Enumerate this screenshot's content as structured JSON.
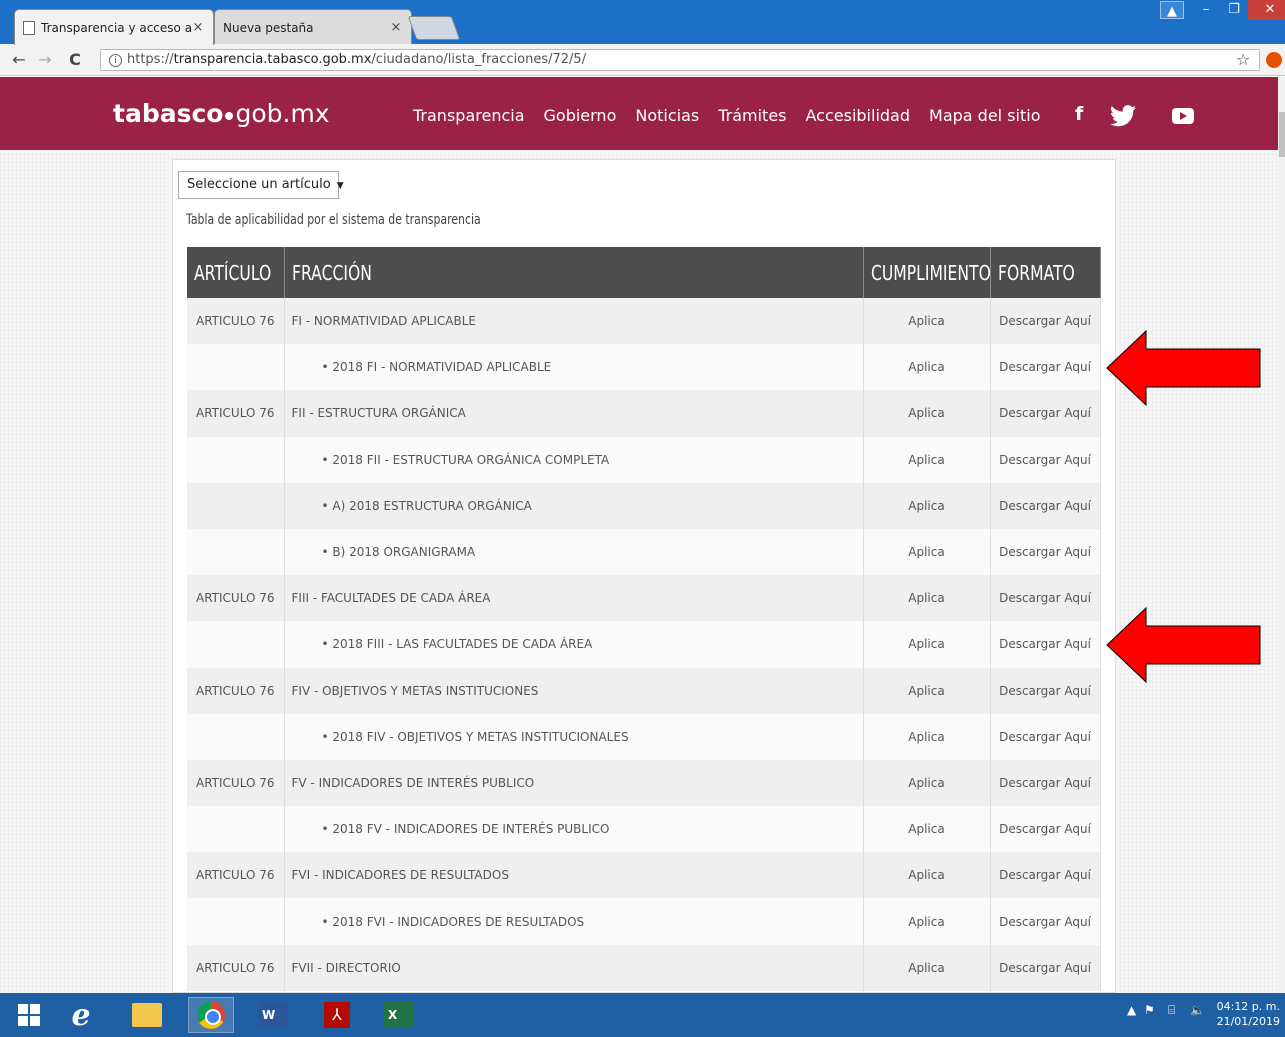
{
  "browser": {
    "tabs": [
      {
        "label": "Transparencia y acceso a",
        "active": true
      },
      {
        "label": "Nueva pestaña",
        "active": false
      }
    ],
    "close_glyph": "×",
    "url_prefix": "https://",
    "url_host": "transparencia.tabasco.gob.mx",
    "url_path": "/ciudadano/lista_fracciones/72/5/"
  },
  "site": {
    "brand_bold": "tabasco",
    "brand_light": "gob.mx",
    "nav": [
      "Transparencia",
      "Gobierno",
      "Noticias",
      "Trámites",
      "Accesibilidad",
      "Mapa del sitio"
    ],
    "social": {
      "facebook": "f"
    },
    "accent_color": "#9b2247"
  },
  "filter": {
    "select_value": "Seleccione un artículo",
    "caption": "Tabla de aplicabilidad por el sistema de transparencia"
  },
  "table": {
    "headers": {
      "articulo": "ARTÍCULO",
      "fraccion": "FRACCIÓN",
      "cumplimiento": "CUMPLIMIENTO",
      "formato": "FORMATO"
    },
    "rows": [
      {
        "articulo": "ARTICULO 76",
        "fraccion": "FI - NORMATIVIDAD APLICABLE",
        "cumplimiento": "Aplica",
        "formato": "Descargar Aquí",
        "sub": false
      },
      {
        "articulo": "",
        "fraccion": "• 2018 FI - NORMATIVIDAD APLICABLE",
        "cumplimiento": "Aplica",
        "formato": "Descargar Aquí",
        "sub": true
      },
      {
        "articulo": "ARTICULO 76",
        "fraccion": "FII - ESTRUCTURA ORGÁNICA",
        "cumplimiento": "Aplica",
        "formato": "Descargar Aquí",
        "sub": false
      },
      {
        "articulo": "",
        "fraccion": "• 2018 FII - ESTRUCTURA ORGÁNICA COMPLETA",
        "cumplimiento": "Aplica",
        "formato": "Descargar Aquí",
        "sub": true
      },
      {
        "articulo": "",
        "fraccion": "• A) 2018 ESTRUCTURA ORGÁNICA",
        "cumplimiento": "Aplica",
        "formato": "Descargar Aquí",
        "sub": true
      },
      {
        "articulo": "",
        "fraccion": "• B) 2018 ORGANIGRAMA",
        "cumplimiento": "Aplica",
        "formato": "Descargar Aquí",
        "sub": true
      },
      {
        "articulo": "ARTICULO 76",
        "fraccion": "FIII - FACULTADES DE CADA ÁREA",
        "cumplimiento": "Aplica",
        "formato": "Descargar Aquí",
        "sub": false
      },
      {
        "articulo": "",
        "fraccion": "• 2018 FIII - LAS FACULTADES DE CADA ÁREA",
        "cumplimiento": "Aplica",
        "formato": "Descargar Aquí",
        "sub": true
      },
      {
        "articulo": "ARTICULO 76",
        "fraccion": "FIV - OBJETIVOS Y METAS INSTITUCIONES",
        "cumplimiento": "Aplica",
        "formato": "Descargar Aquí",
        "sub": false
      },
      {
        "articulo": "",
        "fraccion": "• 2018 FIV - OBJETIVOS Y METAS INSTITUCIONALES",
        "cumplimiento": "Aplica",
        "formato": "Descargar Aquí",
        "sub": true
      },
      {
        "articulo": "ARTICULO 76",
        "fraccion": "FV - INDICADORES DE INTERÉS PUBLICO",
        "cumplimiento": "Aplica",
        "formato": "Descargar Aquí",
        "sub": false
      },
      {
        "articulo": "",
        "fraccion": "• 2018 FV - INDICADORES DE INTERÉS PUBLICO",
        "cumplimiento": "Aplica",
        "formato": "Descargar Aquí",
        "sub": true
      },
      {
        "articulo": "ARTICULO 76",
        "fraccion": "FVI - INDICADORES DE RESULTADOS",
        "cumplimiento": "Aplica",
        "formato": "Descargar Aquí",
        "sub": false
      },
      {
        "articulo": "",
        "fraccion": "• 2018 FVI - INDICADORES DE RESULTADOS",
        "cumplimiento": "Aplica",
        "formato": "Descargar Aquí",
        "sub": true
      },
      {
        "articulo": "ARTICULO 76",
        "fraccion": "FVII - DIRECTORIO",
        "cumplimiento": "Aplica",
        "formato": "Descargar Aquí",
        "sub": false
      }
    ],
    "link_color": "#c29a6d"
  },
  "annotations": {
    "arrow_color": "#ff0000"
  },
  "taskbar": {
    "word_label": "W",
    "excel_label": "X",
    "time": "04:12 p. m.",
    "date": "21/01/2019"
  }
}
